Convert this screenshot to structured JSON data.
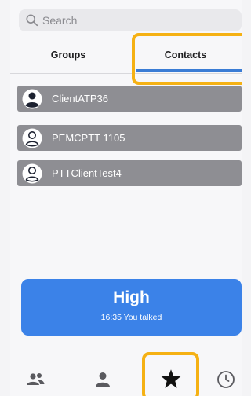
{
  "search": {
    "placeholder": "Search",
    "icon": "search-icon"
  },
  "tabs": [
    {
      "label": "Groups",
      "selected": false
    },
    {
      "label": "Contacts",
      "selected": true
    }
  ],
  "contacts": [
    {
      "name": "ClientATP36",
      "icon": "person-filled-icon"
    },
    {
      "name": "PEMCPTT 1105",
      "icon": "person-outline-icon"
    },
    {
      "name": "PTTClientTest4",
      "icon": "person-outline-icon"
    }
  ],
  "ptt": {
    "level": "High",
    "status": "16:35 You talked"
  },
  "bottom_nav": [
    {
      "name": "groups",
      "icon": "people-icon"
    },
    {
      "name": "contacts",
      "icon": "person-icon"
    },
    {
      "name": "favorites",
      "icon": "star-icon",
      "selected": true
    },
    {
      "name": "recents",
      "icon": "clock-icon"
    }
  ],
  "colors": {
    "accent": "#3b82e8",
    "highlight": "#f5b114",
    "row_bg": "#8e8e93",
    "underline": "#3a7cd5"
  }
}
